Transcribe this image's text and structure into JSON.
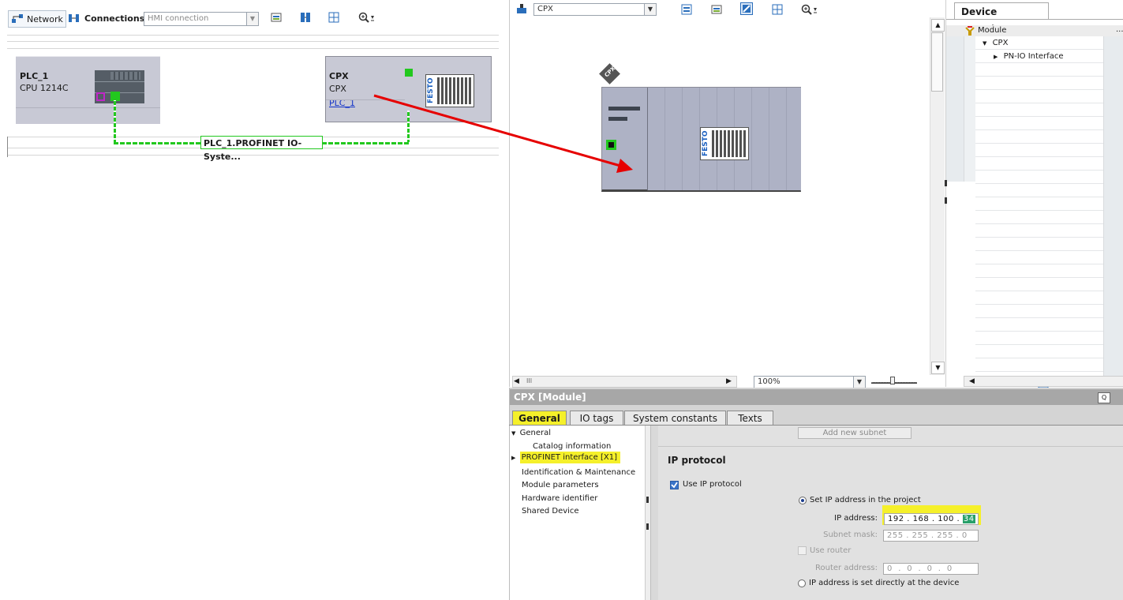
{
  "network_view": {
    "toolbar": {
      "network_label": "Network",
      "connections_label": "Connections",
      "connection_type_value": "HMI connection"
    },
    "plc": {
      "name": "PLC_1",
      "cpu": "CPU 1214C"
    },
    "cpx": {
      "name": "CPX",
      "type": "CPX",
      "assigned_plc": "PLC_1",
      "logo_text": "FESTO"
    },
    "io_system_label": "PLC_1.PROFINET IO-Syste..."
  },
  "device_view": {
    "device_select_value": "CPX",
    "device_tag": "CPX",
    "zoom_value": "100%",
    "h_scrollbar_mark": "III"
  },
  "device_overview": {
    "tab_title": "Device overview",
    "column_module": "Module",
    "column_more": "...",
    "rows": [
      {
        "expander": "▼",
        "label": "CPX"
      },
      {
        "expander": "▶",
        "label": "PN-IO Interface"
      }
    ]
  },
  "properties": {
    "title": "CPX [Module]",
    "tabs": [
      "General",
      "IO tags",
      "System constants",
      "Texts"
    ],
    "nav": [
      {
        "expander": "▼",
        "label": "General"
      },
      {
        "expander": "",
        "label": "Catalog information"
      },
      {
        "expander": "▶",
        "label": "PROFINET interface [X1]"
      },
      {
        "expander": "",
        "label": "Identification & Maintenance"
      },
      {
        "expander": "",
        "label": "Module parameters"
      },
      {
        "expander": "",
        "label": "Hardware identifier"
      },
      {
        "expander": "",
        "label": "Shared Device"
      }
    ],
    "add_subnet_label": "Add new subnet",
    "ip_protocol_heading": "IP protocol",
    "use_ip_protocol_label": "Use IP protocol",
    "set_ip_in_project_label": "Set IP address in the project",
    "ip_address_label": "IP address:",
    "ip_address": [
      "192",
      "168",
      "100",
      "34"
    ],
    "subnet_mask_label": "Subnet mask:",
    "subnet_mask": [
      "255",
      "255",
      "255",
      "0"
    ],
    "use_router_label": "Use router",
    "router_address_label": "Router address:",
    "router_address": [
      "0",
      "0",
      "0",
      "0"
    ],
    "ip_set_at_device_label": "IP address is set directly at the device"
  },
  "colors": {
    "highlight": "#f5f02a",
    "profinet_green": "#22c81e",
    "arrow_red": "#e60000",
    "device_gray": "#c8c9d5"
  }
}
